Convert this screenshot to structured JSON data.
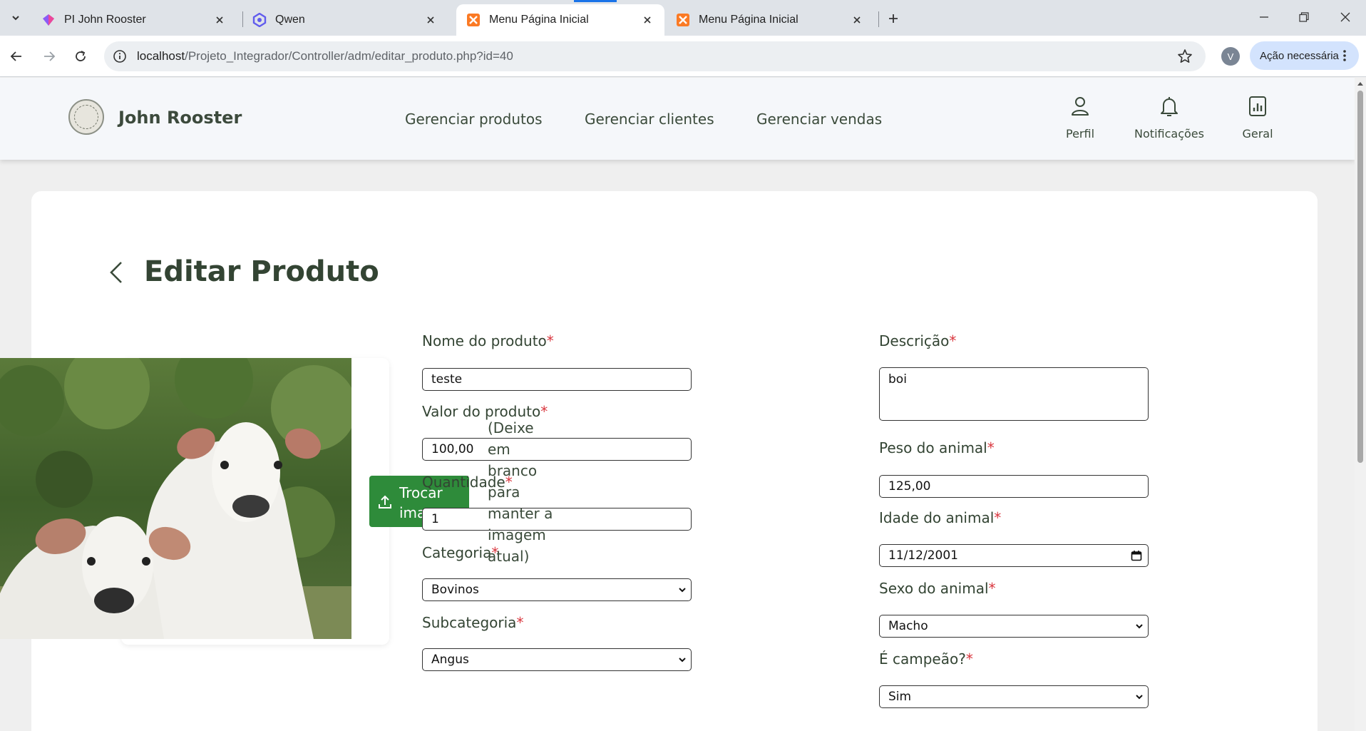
{
  "browser": {
    "tabs": [
      {
        "title": "PI John Rooster",
        "icon": "gem-favicon-icon"
      },
      {
        "title": "Qwen",
        "icon": "qwen-favicon-icon"
      },
      {
        "title": "Menu Página Inicial",
        "icon": "xampp-favicon-icon",
        "active": true
      },
      {
        "title": "Menu Página Inicial",
        "icon": "xampp-favicon-icon"
      }
    ],
    "url_host": "localhost",
    "url_path": "/Projeto_Integrador/Controller/adm/editar_produto.php?id=40",
    "profile_initial": "V",
    "action_label": "Ação necessária"
  },
  "header": {
    "brand": "John Rooster",
    "nav": [
      "Gerenciar produtos",
      "Gerenciar clientes",
      "Gerenciar vendas"
    ],
    "icons": [
      {
        "label": "Perfil",
        "icon": "user-icon"
      },
      {
        "label": "Notificações",
        "icon": "bell-icon"
      },
      {
        "label": "Geral",
        "icon": "report-icon"
      }
    ]
  },
  "page": {
    "title": "Editar Produto",
    "swap_image_label": "Trocar imagem",
    "image_hint": "(Deixe em branco para manter a imagem atual)"
  },
  "form": {
    "nome": {
      "label": "Nome do produto",
      "value": "teste"
    },
    "valor": {
      "label": "Valor do produto",
      "value": "100,00"
    },
    "quantidade": {
      "label": "Quantidade",
      "value": "1"
    },
    "categoria": {
      "label": "Categoria",
      "value": "Bovinos"
    },
    "subcategoria": {
      "label": "Subcategoria",
      "value": "Angus"
    },
    "descricao": {
      "label": "Descrição",
      "value": "boi"
    },
    "peso": {
      "label": "Peso do animal",
      "value": "125,00"
    },
    "idade": {
      "label": "Idade do animal",
      "value": "11/12/2001"
    },
    "sexo": {
      "label": "Sexo do animal",
      "value": "Macho"
    },
    "campeao": {
      "label": "É campeão?",
      "value": "Sim"
    },
    "required_mark": "*"
  },
  "colors": {
    "accent_green": "#2e8b3a",
    "required_red": "#d9363e",
    "heading": "#334433"
  }
}
